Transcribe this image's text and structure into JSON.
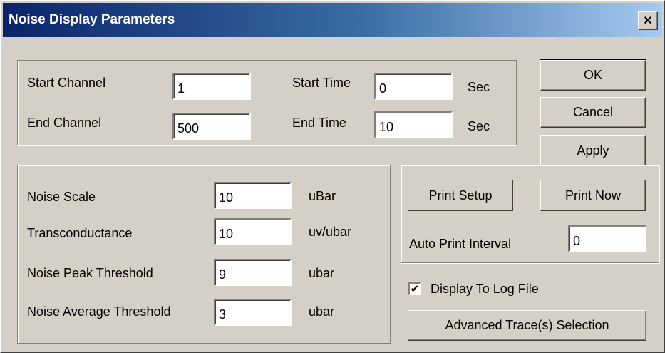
{
  "window": {
    "title": "Noise Display Parameters",
    "close_glyph": "×"
  },
  "channels": {
    "start_channel_label": "Start Channel",
    "start_channel_value": "1",
    "end_channel_label": "End Channel",
    "end_channel_value": "500",
    "start_time_label": "Start Time",
    "start_time_value": "0",
    "start_time_unit": "Sec",
    "end_time_label": "End Time",
    "end_time_value": "10",
    "end_time_unit": "Sec"
  },
  "buttons": {
    "ok": "OK",
    "cancel": "Cancel",
    "apply": "Apply"
  },
  "noise": {
    "scale_label": "Noise Scale",
    "scale_value": "10",
    "scale_unit": "uBar",
    "transconductance_label": "Transconductance",
    "transconductance_value": "10",
    "transconductance_unit": "uv/ubar",
    "peak_label": "Noise Peak Threshold",
    "peak_value": "9",
    "peak_unit": "ubar",
    "average_label": "Noise Average Threshold",
    "average_value": "3",
    "average_unit": "ubar"
  },
  "print": {
    "setup_label": "Print Setup",
    "now_label": "Print Now",
    "interval_label": "Auto Print Interval",
    "interval_value": "0"
  },
  "log": {
    "checkbox_label": "Display To Log File",
    "checked": true,
    "check_glyph": "✔"
  },
  "advanced": {
    "label": "Advanced Trace(s) Selection"
  }
}
